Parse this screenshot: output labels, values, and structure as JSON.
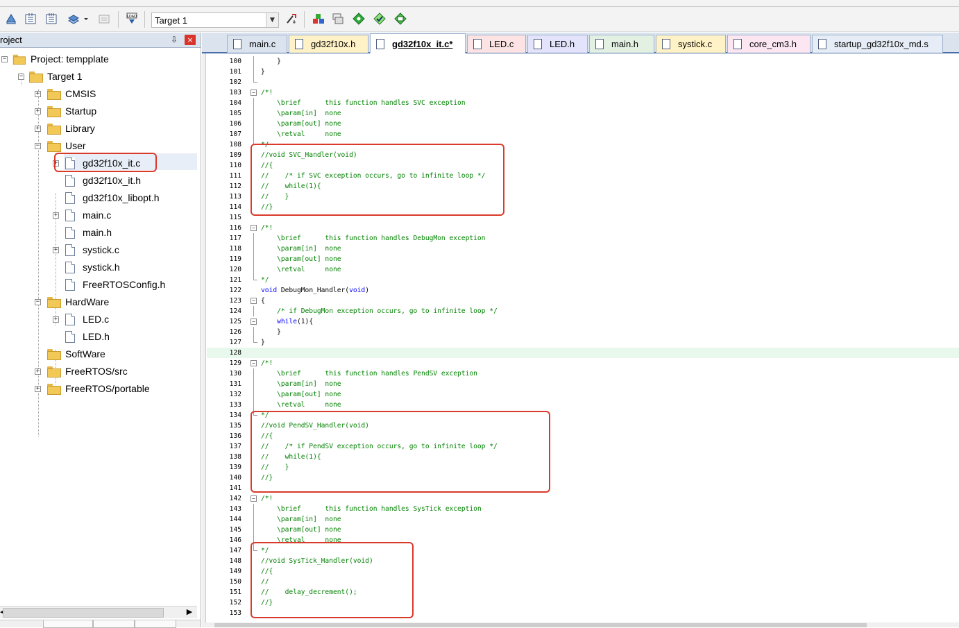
{
  "toolbar": {
    "target_value": "Target 1"
  },
  "project_panel": {
    "title": "roject",
    "pin_glyph": "←",
    "close_glyph": "×",
    "tree": [
      {
        "label": "Project: tempplate",
        "kind": "project"
      },
      {
        "label": "Target 1",
        "kind": "target"
      },
      {
        "label": "CMSIS",
        "kind": "folder"
      },
      {
        "label": "Startup",
        "kind": "folder"
      },
      {
        "label": "Library",
        "kind": "folder"
      },
      {
        "label": "User",
        "kind": "folder"
      },
      {
        "label": "gd32f10x_it.c",
        "kind": "file",
        "highlighted": true
      },
      {
        "label": "gd32f10x_it.h",
        "kind": "file"
      },
      {
        "label": "gd32f10x_libopt.h",
        "kind": "file"
      },
      {
        "label": "main.c",
        "kind": "file"
      },
      {
        "label": "main.h",
        "kind": "file"
      },
      {
        "label": "systick.c",
        "kind": "file"
      },
      {
        "label": "systick.h",
        "kind": "file"
      },
      {
        "label": "FreeRTOSConfig.h",
        "kind": "file"
      },
      {
        "label": "HardWare",
        "kind": "folder"
      },
      {
        "label": "LED.c",
        "kind": "file"
      },
      {
        "label": "LED.h",
        "kind": "file"
      },
      {
        "label": "SoftWare",
        "kind": "folder"
      },
      {
        "label": "FreeRTOS/src",
        "kind": "folder"
      },
      {
        "label": "FreeRTOS/portable",
        "kind": "folder"
      }
    ]
  },
  "editor": {
    "tabs": [
      {
        "label": "main.c",
        "active": false,
        "color": "#dbe3ee"
      },
      {
        "label": "gd32f10x.h",
        "active": false,
        "color": "#fff2c6"
      },
      {
        "label": "gd32f10x_it.c*",
        "active": true,
        "color": "#ffffff"
      },
      {
        "label": "LED.c",
        "active": false,
        "color": "#fde3e3"
      },
      {
        "label": "LED.h",
        "active": false,
        "color": "#e3e3fb"
      },
      {
        "label": "main.h",
        "active": false,
        "color": "#e3f1e3"
      },
      {
        "label": "systick.c",
        "active": false,
        "color": "#fff2c6"
      },
      {
        "label": "core_cm3.h",
        "active": false,
        "color": "#fbe6f2"
      },
      {
        "label": "startup_gd32f10x_md.s",
        "active": false,
        "color": "#e7edf6"
      }
    ],
    "lines": [
      {
        "n": "100",
        "fold": "line",
        "segs": [
          {
            "t": "    }",
            "c": "def"
          }
        ]
      },
      {
        "n": "101",
        "fold": "line",
        "segs": [
          {
            "t": "}",
            "c": "def"
          }
        ]
      },
      {
        "n": "102",
        "fold": "end",
        "segs": []
      },
      {
        "n": "103",
        "fold": "box",
        "segs": [
          {
            "t": "/*!",
            "c": "cmt"
          }
        ]
      },
      {
        "n": "104",
        "fold": "line",
        "segs": [
          {
            "t": "    \\brief      this function handles SVC exception",
            "c": "cmt"
          }
        ]
      },
      {
        "n": "105",
        "fold": "line",
        "segs": [
          {
            "t": "    \\param[in]  none",
            "c": "cmt"
          }
        ]
      },
      {
        "n": "106",
        "fold": "line",
        "segs": [
          {
            "t": "    \\param[out] none",
            "c": "cmt"
          }
        ]
      },
      {
        "n": "107",
        "fold": "line",
        "segs": [
          {
            "t": "    \\retval     none",
            "c": "cmt"
          }
        ]
      },
      {
        "n": "108",
        "fold": "end",
        "segs": [
          {
            "t": "*/",
            "c": "cmt"
          }
        ]
      },
      {
        "n": "109",
        "fold": "",
        "segs": [
          {
            "t": "//void SVC_Handler(void)",
            "c": "cmt"
          }
        ]
      },
      {
        "n": "110",
        "fold": "",
        "segs": [
          {
            "t": "//{",
            "c": "cmt"
          }
        ]
      },
      {
        "n": "111",
        "fold": "",
        "segs": [
          {
            "t": "//    /* if SVC exception occurs, go to infinite loop */",
            "c": "cmt"
          }
        ]
      },
      {
        "n": "112",
        "fold": "",
        "segs": [
          {
            "t": "//    while(1){",
            "c": "cmt"
          }
        ]
      },
      {
        "n": "113",
        "fold": "",
        "segs": [
          {
            "t": "//    }",
            "c": "cmt"
          }
        ]
      },
      {
        "n": "114",
        "fold": "",
        "segs": [
          {
            "t": "//}",
            "c": "cmt"
          }
        ]
      },
      {
        "n": "115",
        "fold": "",
        "segs": []
      },
      {
        "n": "116",
        "fold": "box",
        "segs": [
          {
            "t": "/*!",
            "c": "cmt"
          }
        ]
      },
      {
        "n": "117",
        "fold": "line",
        "segs": [
          {
            "t": "    \\brief      this function handles DebugMon exception",
            "c": "cmt"
          }
        ]
      },
      {
        "n": "118",
        "fold": "line",
        "segs": [
          {
            "t": "    \\param[in]  none",
            "c": "cmt"
          }
        ]
      },
      {
        "n": "119",
        "fold": "line",
        "segs": [
          {
            "t": "    \\param[out] none",
            "c": "cmt"
          }
        ]
      },
      {
        "n": "120",
        "fold": "line",
        "segs": [
          {
            "t": "    \\retval     none",
            "c": "cmt"
          }
        ]
      },
      {
        "n": "121",
        "fold": "end",
        "segs": [
          {
            "t": "*/",
            "c": "cmt"
          }
        ]
      },
      {
        "n": "122",
        "fold": "",
        "segs": [
          {
            "t": "void",
            "c": "kw"
          },
          {
            "t": " DebugMon_Handler(",
            "c": "def"
          },
          {
            "t": "void",
            "c": "kw"
          },
          {
            "t": ")",
            "c": "def"
          }
        ]
      },
      {
        "n": "123",
        "fold": "box",
        "segs": [
          {
            "t": "{",
            "c": "def"
          }
        ]
      },
      {
        "n": "124",
        "fold": "line",
        "segs": [
          {
            "t": "    /* if DebugMon exception occurs, go to infinite loop */",
            "c": "cmt"
          }
        ]
      },
      {
        "n": "125",
        "fold": "box",
        "segs": [
          {
            "t": "    ",
            "c": "def"
          },
          {
            "t": "while",
            "c": "kw"
          },
          {
            "t": "(1){",
            "c": "def"
          }
        ]
      },
      {
        "n": "126",
        "fold": "line",
        "segs": [
          {
            "t": "    }",
            "c": "def"
          }
        ]
      },
      {
        "n": "127",
        "fold": "end",
        "segs": [
          {
            "t": "}",
            "c": "def"
          }
        ]
      },
      {
        "n": "128",
        "fold": "",
        "segs": [],
        "hl": true
      },
      {
        "n": "129",
        "fold": "box",
        "segs": [
          {
            "t": "/*!",
            "c": "cmt"
          }
        ]
      },
      {
        "n": "130",
        "fold": "line",
        "segs": [
          {
            "t": "    \\brief      this function handles PendSV exception",
            "c": "cmt"
          }
        ]
      },
      {
        "n": "131",
        "fold": "line",
        "segs": [
          {
            "t": "    \\param[in]  none",
            "c": "cmt"
          }
        ]
      },
      {
        "n": "132",
        "fold": "line",
        "segs": [
          {
            "t": "    \\param[out] none",
            "c": "cmt"
          }
        ]
      },
      {
        "n": "133",
        "fold": "line",
        "segs": [
          {
            "t": "    \\retval     none",
            "c": "cmt"
          }
        ]
      },
      {
        "n": "134",
        "fold": "end",
        "segs": [
          {
            "t": "*/",
            "c": "cmt"
          }
        ]
      },
      {
        "n": "135",
        "fold": "",
        "segs": [
          {
            "t": "//void PendSV_Handler(void)",
            "c": "cmt"
          }
        ]
      },
      {
        "n": "136",
        "fold": "",
        "segs": [
          {
            "t": "//{",
            "c": "cmt"
          }
        ]
      },
      {
        "n": "137",
        "fold": "",
        "segs": [
          {
            "t": "//    /* if PendSV exception occurs, go to infinite loop */",
            "c": "cmt"
          }
        ]
      },
      {
        "n": "138",
        "fold": "",
        "segs": [
          {
            "t": "//    while(1){",
            "c": "cmt"
          }
        ]
      },
      {
        "n": "139",
        "fold": "",
        "segs": [
          {
            "t": "//    }",
            "c": "cmt"
          }
        ]
      },
      {
        "n": "140",
        "fold": "",
        "segs": [
          {
            "t": "//}",
            "c": "cmt"
          }
        ]
      },
      {
        "n": "141",
        "fold": "",
        "segs": []
      },
      {
        "n": "142",
        "fold": "box",
        "segs": [
          {
            "t": "/*!",
            "c": "cmt"
          }
        ]
      },
      {
        "n": "143",
        "fold": "line",
        "segs": [
          {
            "t": "    \\brief      this function handles SysTick exception",
            "c": "cmt"
          }
        ]
      },
      {
        "n": "144",
        "fold": "line",
        "segs": [
          {
            "t": "    \\param[in]  none",
            "c": "cmt"
          }
        ]
      },
      {
        "n": "145",
        "fold": "line",
        "segs": [
          {
            "t": "    \\param[out] none",
            "c": "cmt"
          }
        ]
      },
      {
        "n": "146",
        "fold": "line",
        "segs": [
          {
            "t": "    \\retval     none",
            "c": "cmt"
          }
        ]
      },
      {
        "n": "147",
        "fold": "end",
        "segs": [
          {
            "t": "*/",
            "c": "cmt"
          }
        ]
      },
      {
        "n": "148",
        "fold": "",
        "segs": [
          {
            "t": "//void SysTick_Handler(void)",
            "c": "cmt"
          }
        ]
      },
      {
        "n": "149",
        "fold": "",
        "segs": [
          {
            "t": "//{",
            "c": "cmt"
          }
        ]
      },
      {
        "n": "150",
        "fold": "",
        "segs": [
          {
            "t": "//",
            "c": "cmt"
          }
        ]
      },
      {
        "n": "151",
        "fold": "",
        "segs": [
          {
            "t": "//    delay_decrement();",
            "c": "cmt"
          }
        ]
      },
      {
        "n": "152",
        "fold": "",
        "segs": [
          {
            "t": "//}",
            "c": "cmt"
          }
        ]
      },
      {
        "n": "153",
        "fold": "",
        "segs": []
      }
    ]
  },
  "colors": {
    "annotation_red": "#d93a2b",
    "comment_green": "#008000",
    "keyword_blue": "#0000ff",
    "current_line": "#e8f8ec"
  }
}
